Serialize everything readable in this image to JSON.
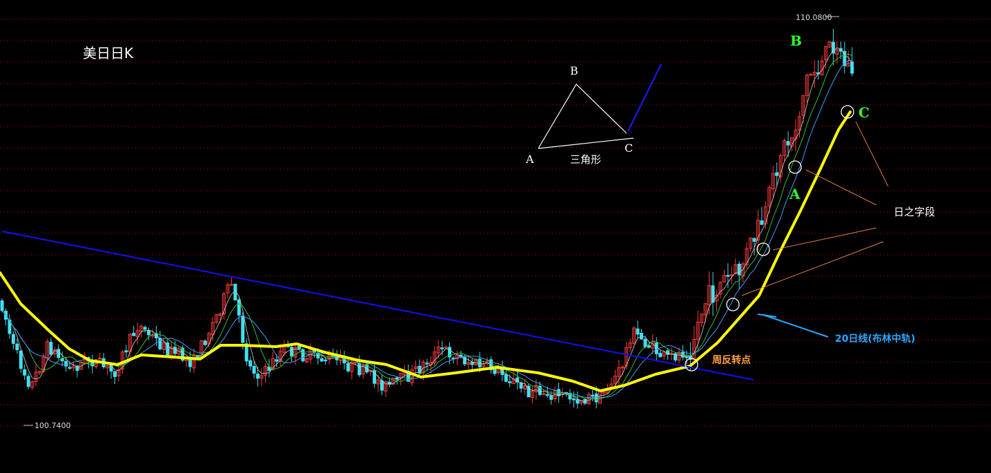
{
  "chart_data": {
    "type": "candlestick",
    "title": "美日日K",
    "price_max_label": "110.0800",
    "price_min_label": "100.7400",
    "annotations": {
      "triangle_label": "三角形",
      "triangle_point_a": "A",
      "triangle_point_b": "B",
      "triangle_point_c": "C",
      "wave_b": "B",
      "wave_a": "A",
      "wave_c": "C",
      "day_segment": "日之字段",
      "ma20_note": "20日线(布林中轨)",
      "weekly_reversal": "周反转点"
    },
    "colors": {
      "up": "#ff3b3b",
      "down": "#40e0f0",
      "ma20": "#ffff00",
      "trendline": "#1010e0",
      "ma_fast": "#40a0ff",
      "ma_mid": "#30c030",
      "ma_slow": "#c0c0c0",
      "grid": "#7a0000",
      "label_green": "#30ff30",
      "label_orange": "#ffa040",
      "label_blue": "#2aa8ff"
    }
  }
}
